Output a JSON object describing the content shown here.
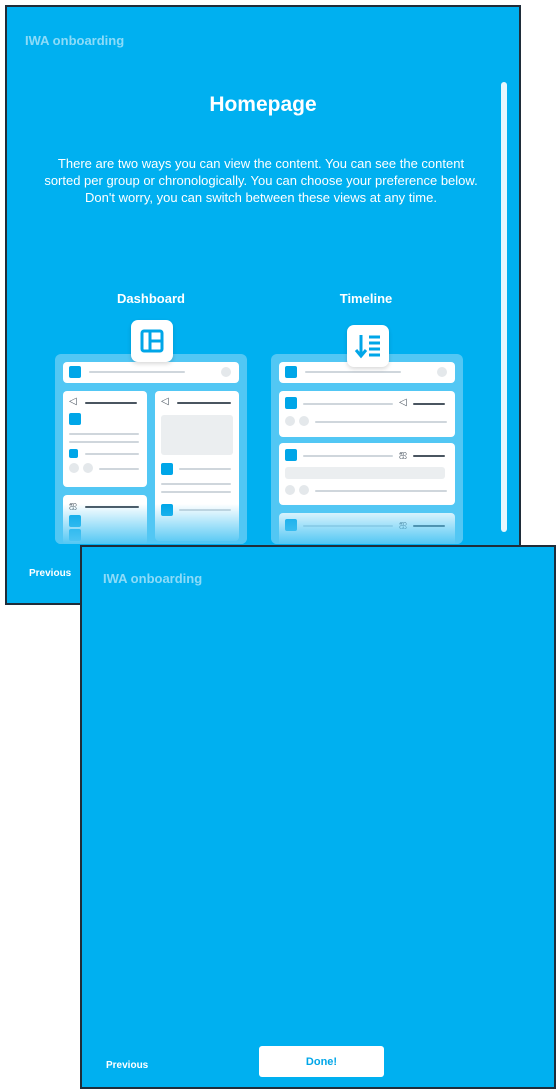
{
  "app": {
    "title": "IWA onboarding"
  },
  "step_one": {
    "heading": "Homepage",
    "body": "There are two ways you can view the content. You can see the content sorted per group or chronologically. You can choose your preference below. Don't worry, you can switch between these views at any time.",
    "views": [
      {
        "label": "Dashboard",
        "icon": "dashboard-layout-icon"
      },
      {
        "label": "Timeline",
        "icon": "timeline-sort-icon"
      }
    ],
    "previous_label": "Previous"
  },
  "step_two": {
    "previous_label": "Previous",
    "done_label": "Done!"
  },
  "colors": {
    "panel": "#00b0f0",
    "mock_bg": "#52c7f4",
    "accent_square": "#00a6e8",
    "button_text": "#00a6e8"
  }
}
